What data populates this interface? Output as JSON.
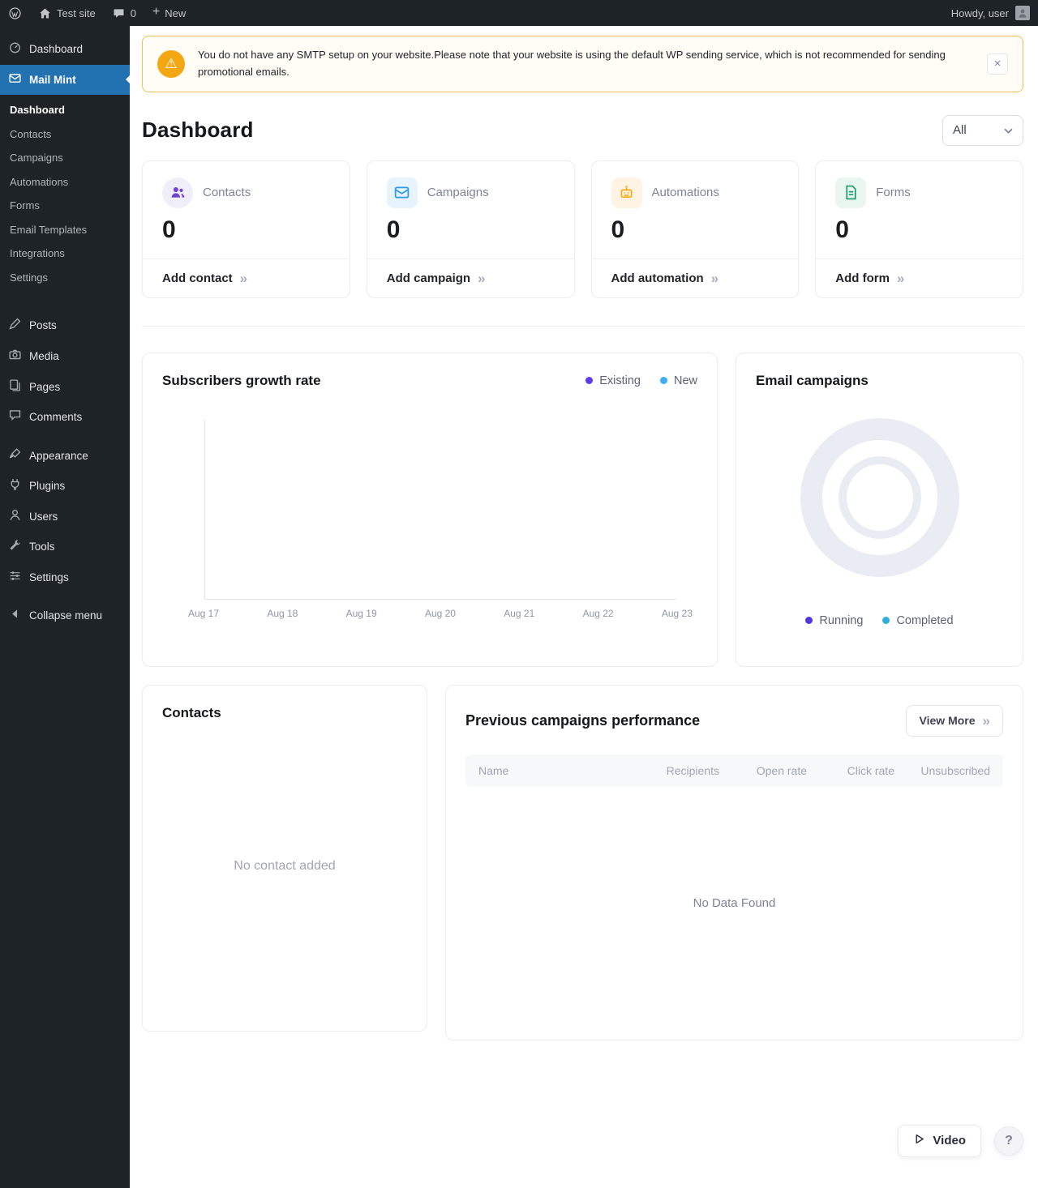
{
  "admin_bar": {
    "site_name": "Test site",
    "comments_count": "0",
    "new_label": "New",
    "howdy_text": "Howdy, user"
  },
  "sidebar": {
    "dashboard": "Dashboard",
    "mail_mint": "Mail Mint",
    "submenu": [
      "Dashboard",
      "Contacts",
      "Campaigns",
      "Automations",
      "Forms",
      "Email Templates",
      "Integrations",
      "Settings"
    ],
    "posts": "Posts",
    "media": "Media",
    "pages": "Pages",
    "comments": "Comments",
    "appearance": "Appearance",
    "plugins": "Plugins",
    "users": "Users",
    "tools": "Tools",
    "settings": "Settings",
    "collapse": "Collapse menu"
  },
  "notice": {
    "message": "You do not have any SMTP setup on your website.Please note that your website is using the default WP sending service, which is not recommended for sending promotional emails.",
    "close_label": "×"
  },
  "page": {
    "title": "Dashboard",
    "filter_value": "All"
  },
  "stats": [
    {
      "label": "Contacts",
      "value": "0",
      "action": "Add contact",
      "accent": "#6E42D3"
    },
    {
      "label": "Campaigns",
      "value": "0",
      "action": "Add campaign",
      "accent": "#2E9BE6"
    },
    {
      "label": "Automations",
      "value": "0",
      "action": "Add automation",
      "accent": "#F6A609"
    },
    {
      "label": "Forms",
      "value": "0",
      "action": "Add form",
      "accent": "#22A06B"
    }
  ],
  "growth_chart": {
    "title": "Subscribers growth rate",
    "legend": [
      {
        "label": "Existing",
        "color": "#5E3BEE"
      },
      {
        "label": "New",
        "color": "#38AEF5"
      }
    ],
    "x_labels": [
      "Aug 17",
      "Aug 18",
      "Aug 19",
      "Aug 20",
      "Aug 21",
      "Aug 22",
      "Aug 23"
    ],
    "series_values": []
  },
  "email_campaigns": {
    "title": "Email campaigns",
    "legend": [
      {
        "label": "Running",
        "color": "#4E36E2"
      },
      {
        "label": "Completed",
        "color": "#2BB2D8"
      }
    ]
  },
  "contacts_panel": {
    "title": "Contacts",
    "empty_text": "No contact added"
  },
  "campaigns_table": {
    "title": "Previous campaigns performance",
    "view_more_label": "View More",
    "headers": [
      "Name",
      "Recipients",
      "Open rate",
      "Click rate",
      "Unsubscribed"
    ],
    "empty_text": "No Data Found"
  },
  "footer": {
    "video_label": "Video",
    "help_label": "?"
  }
}
